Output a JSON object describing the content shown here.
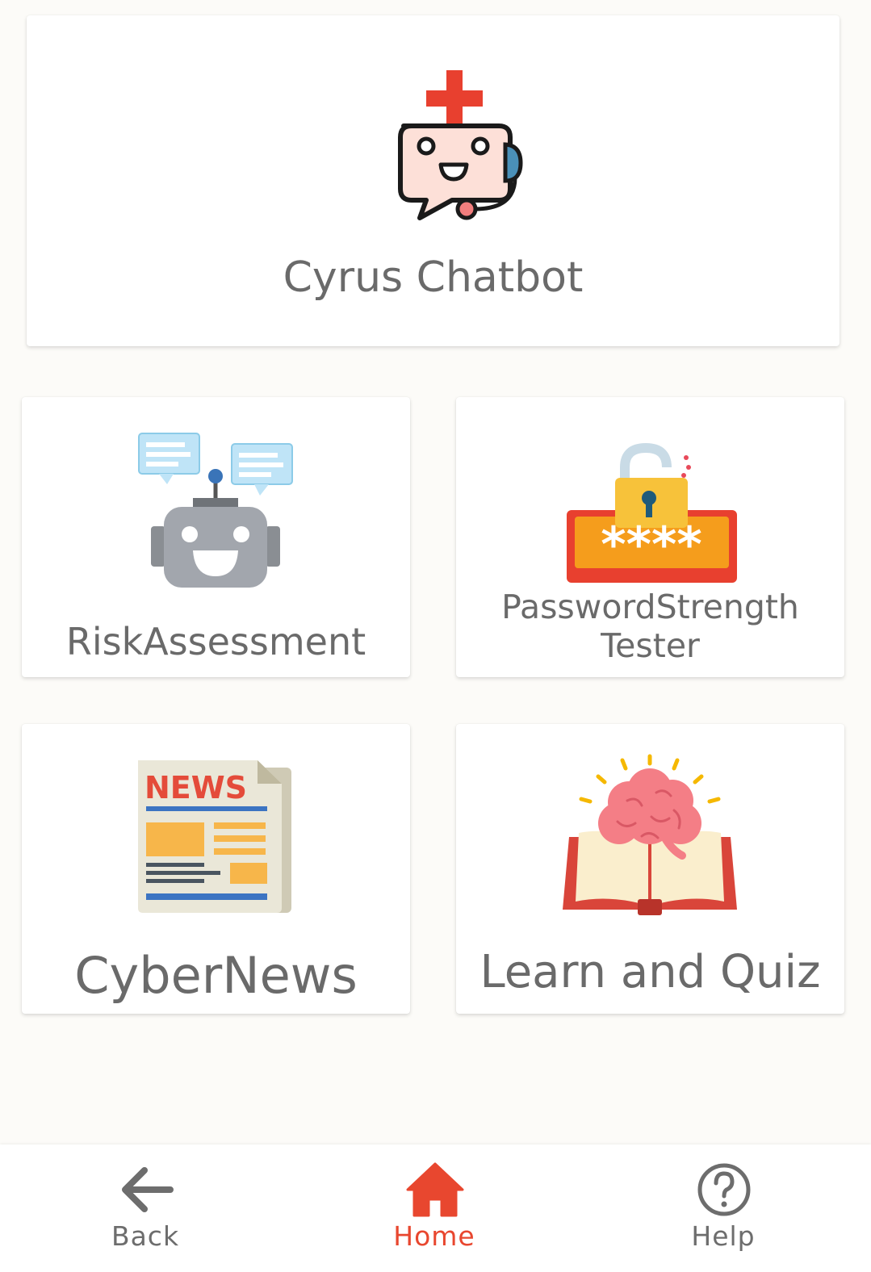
{
  "cards": {
    "chatbot": {
      "label": "Cyrus Chatbot",
      "icon": "robot-medic-chat-icon"
    },
    "risk": {
      "label": "RiskAssessment",
      "icon": "robot-chat-icon"
    },
    "password": {
      "label": "PasswordStrength Tester",
      "icon": "password-lock-icon",
      "masked_text": "****"
    },
    "news": {
      "label": "CyberNews",
      "icon": "newspaper-icon",
      "masthead": "NEWS"
    },
    "quiz": {
      "label": "Learn and Quiz",
      "icon": "brain-book-icon"
    }
  },
  "bottom_nav": {
    "back": {
      "label": "Back",
      "icon": "arrow-left-icon"
    },
    "home": {
      "label": "Home",
      "icon": "home-icon",
      "active": true
    },
    "help": {
      "label": "Help",
      "icon": "help-circle-icon"
    }
  },
  "colors": {
    "accent": "#e8472f",
    "label_text": "#6a6a6a",
    "background": "#fcfbf8"
  }
}
